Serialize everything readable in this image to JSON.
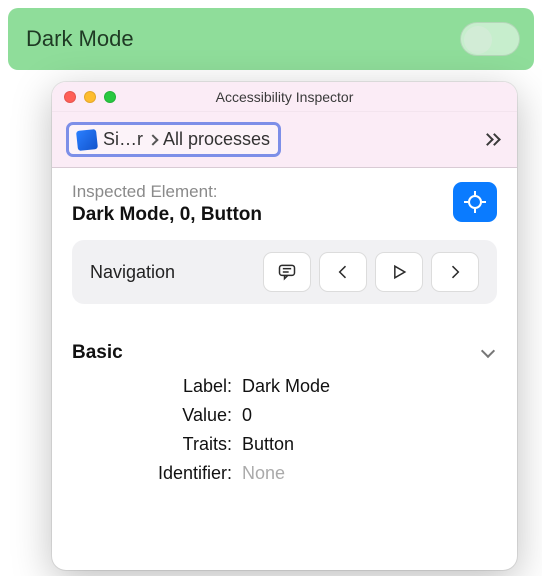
{
  "highlighted": {
    "label": "Dark Mode",
    "toggle_on": false
  },
  "window": {
    "title": "Accessibility Inspector"
  },
  "breadcrumb": {
    "target_abbrev": "Si…r",
    "scope": "All processes"
  },
  "inspected": {
    "caption": "Inspected Element:",
    "summary": "Dark Mode, 0, Button"
  },
  "navigation": {
    "label": "Navigation"
  },
  "section": {
    "title": "Basic",
    "rows": {
      "label_key": "Label:",
      "label_val": "Dark Mode",
      "value_key": "Value:",
      "value_val": "0",
      "traits_key": "Traits:",
      "traits_val": "Button",
      "identifier_key": "Identifier:",
      "identifier_val": "None"
    }
  }
}
